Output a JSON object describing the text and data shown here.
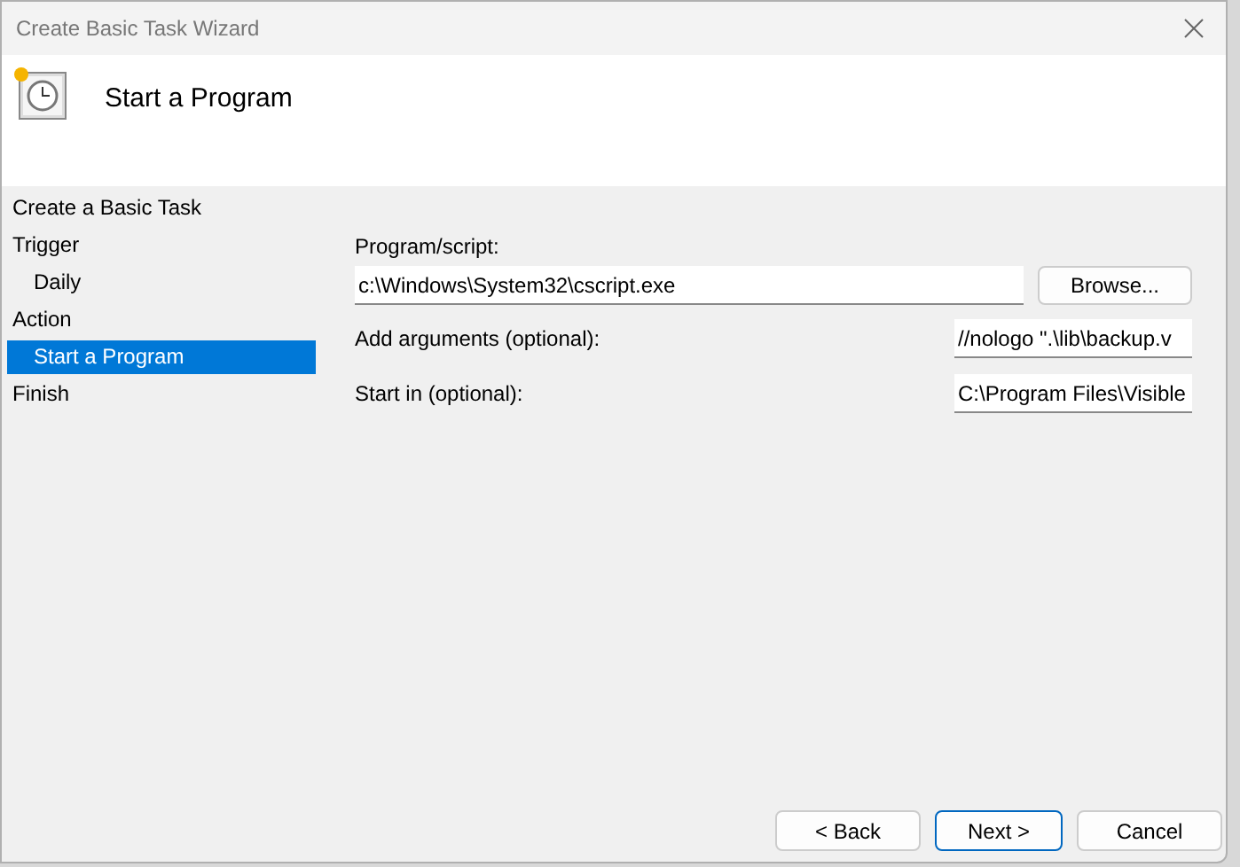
{
  "window": {
    "title": "Create Basic Task Wizard"
  },
  "header": {
    "title": "Start a Program"
  },
  "steps": [
    {
      "label": "Create a Basic Task",
      "selected": false
    },
    {
      "label": "Trigger",
      "selected": false,
      "children": [
        {
          "label": "Daily",
          "selected": false
        }
      ]
    },
    {
      "label": "Action",
      "selected": false,
      "children": [
        {
          "label": "Start a Program",
          "selected": true
        }
      ]
    },
    {
      "label": "Finish",
      "selected": false
    }
  ],
  "program": {
    "label": "Program/script:",
    "value": "c:\\Windows\\System32\\cscript.exe",
    "browse": "Browse..."
  },
  "fields": [
    {
      "label": "Add arguments (optional):",
      "value": "//nologo \".\\lib\\backup.v"
    },
    {
      "label": "Start in (optional):",
      "value": "C:\\Program Files\\Visible"
    }
  ],
  "buttons": [
    {
      "label": "< Back",
      "kind": "normal"
    },
    {
      "label": "Next >",
      "kind": "default"
    },
    {
      "label": "Cancel",
      "kind": "normal"
    }
  ]
}
